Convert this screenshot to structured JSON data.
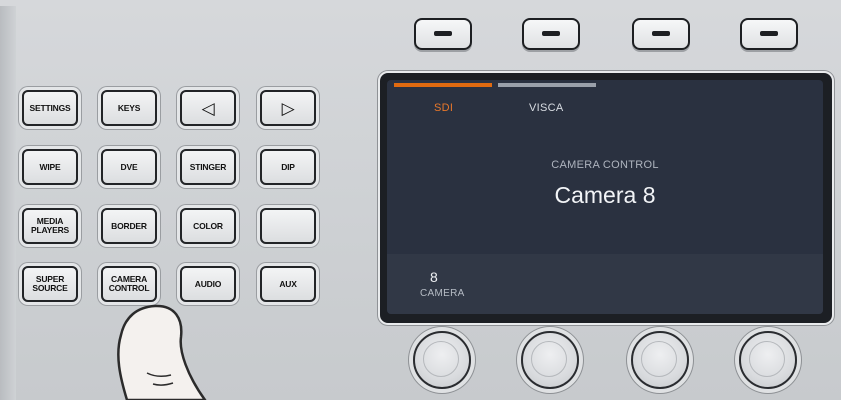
{
  "softkeys": [
    {
      "name": "soft-key-1",
      "icon": "dash-icon"
    },
    {
      "name": "soft-key-2",
      "icon": "dash-icon"
    },
    {
      "name": "soft-key-3",
      "icon": "dash-icon"
    },
    {
      "name": "soft-key-4",
      "icon": "dash-icon"
    }
  ],
  "buttons": {
    "settings": "SETTINGS",
    "keys": "KEYS",
    "prev": "◁",
    "next": "▷",
    "wipe": "WIPE",
    "dve": "DVE",
    "stinger": "STINGER",
    "dip": "DIP",
    "media_players": "MEDIA\nPLAYERS",
    "border": "BORDER",
    "color": "COLOR",
    "blank": "",
    "super_source": "SUPER\nSOURCE",
    "camera_control": "CAMERA\nCONTROL",
    "audio": "AUDIO",
    "aux": "AUX"
  },
  "lcd": {
    "tabs": [
      {
        "label": "SDI",
        "active": true
      },
      {
        "label": "VISCA",
        "active": false
      }
    ],
    "menu_title": "CAMERA CONTROL",
    "menu_value": "Camera 8",
    "parameter": {
      "value": "8",
      "label": "CAMERA"
    }
  },
  "colors": {
    "accent": "#e06a10",
    "lcd_background": "#2a3140",
    "panel": "#d2d4d7"
  }
}
